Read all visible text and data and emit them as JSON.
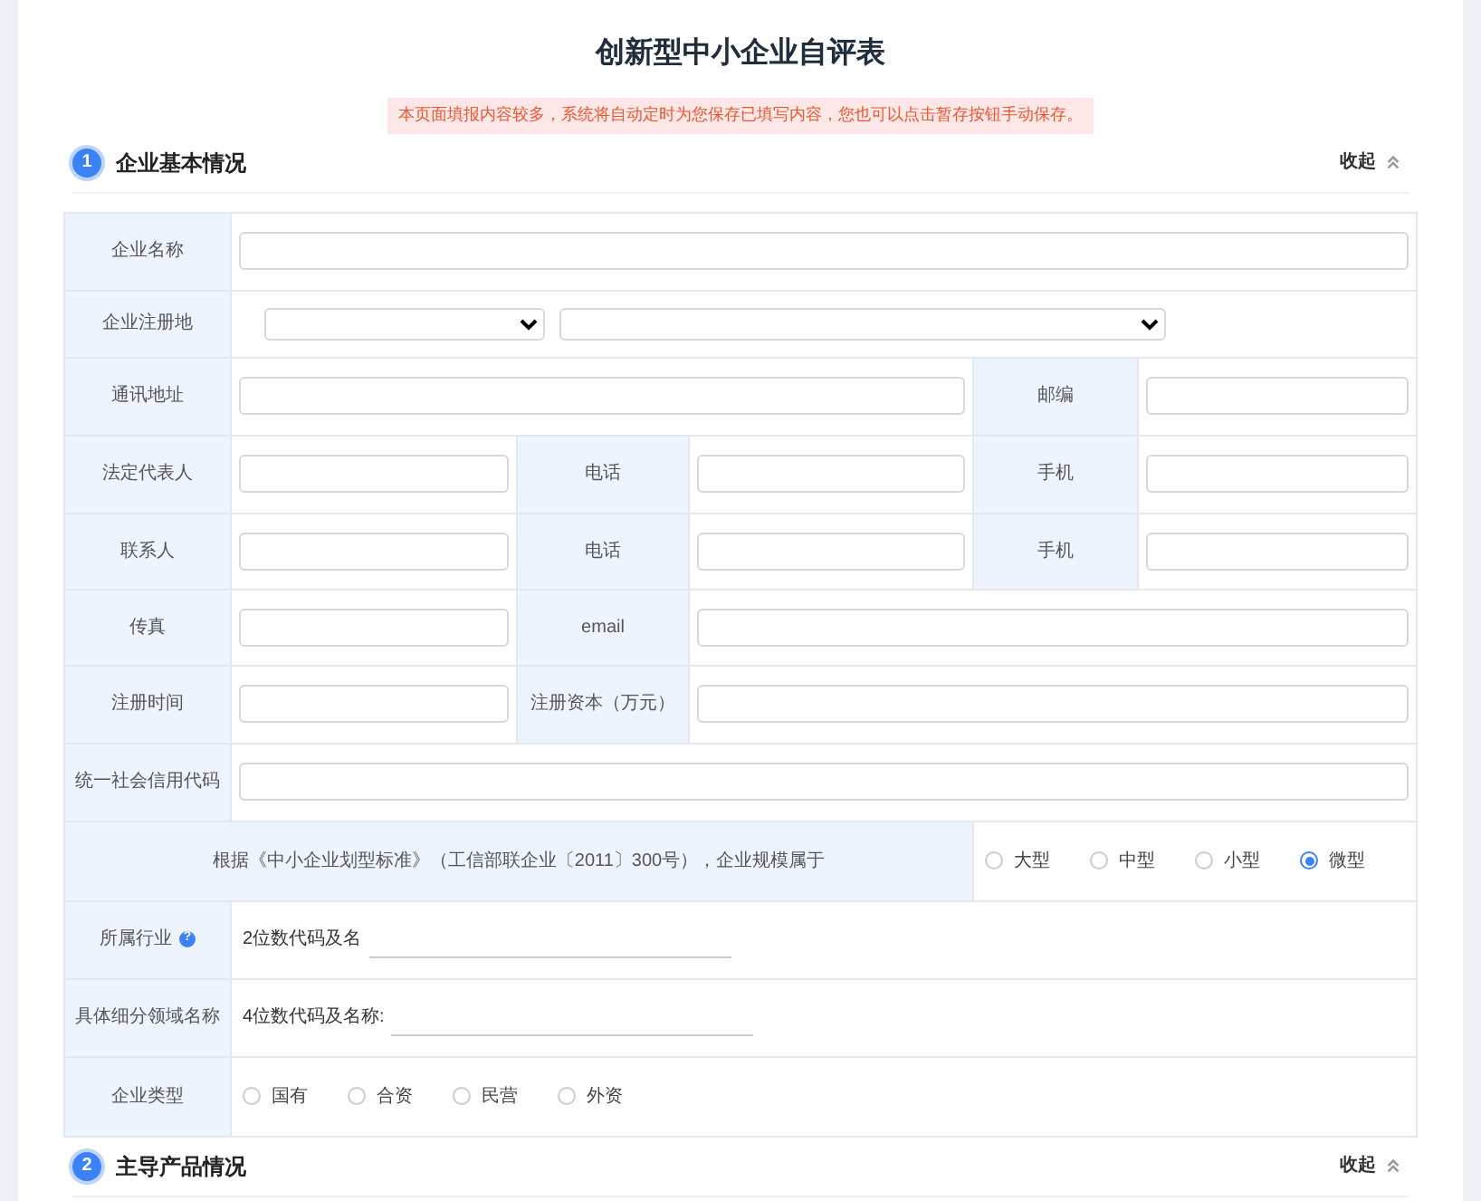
{
  "title": "创新型中小企业自评表",
  "notice": "本页面填报内容较多，系统将自动定时为您保存已填写内容，您也可以点击暂存按钮手动保存。",
  "sections": [
    {
      "number": "1",
      "title": "企业基本情况",
      "toggle": "收起"
    },
    {
      "number": "2",
      "title": "主导产品情况",
      "toggle": "收起"
    }
  ],
  "rows": [
    {
      "kind": "wide",
      "labels": [
        "企业名称"
      ]
    },
    {
      "kind": "selects",
      "labels": [
        "企业注册地"
      ]
    },
    {
      "kind": "address",
      "labels": [
        "通讯地址",
        "邮编"
      ]
    },
    {
      "kind": "triple",
      "labels": [
        "法定代表人",
        "电话",
        "手机"
      ]
    },
    {
      "kind": "triple",
      "labels": [
        "联系人",
        "电话",
        "手机"
      ]
    },
    {
      "kind": "pair",
      "labels": [
        "传真",
        "email"
      ]
    },
    {
      "kind": "pair",
      "labels": [
        "注册时间",
        "注册资本（万元）"
      ]
    },
    {
      "kind": "wide",
      "labels": [
        "统一社会信用代码"
      ]
    },
    {
      "kind": "choice",
      "labels": [
        "根据《中小企业划型标准》（工信部联企业〔2011〕300号），企业规模属于"
      ],
      "options": [
        {
          "label": "大型",
          "selected": false
        },
        {
          "label": "中型",
          "selected": false
        },
        {
          "label": "小型",
          "selected": false
        },
        {
          "label": "微型",
          "selected": true
        }
      ]
    },
    {
      "kind": "code",
      "labels": [
        "所属行业"
      ],
      "help": "?",
      "prefix": "2位数代码及名"
    },
    {
      "kind": "code",
      "labels": [
        "具体细分领域名称"
      ],
      "prefix": "4位数代码及名称:"
    },
    {
      "kind": "radios",
      "labels": [
        "企业类型"
      ],
      "options": [
        {
          "label": "国有",
          "selected": false
        },
        {
          "label": "合资",
          "selected": false
        },
        {
          "label": "民营",
          "selected": false
        },
        {
          "label": "外资",
          "selected": false
        }
      ]
    }
  ]
}
